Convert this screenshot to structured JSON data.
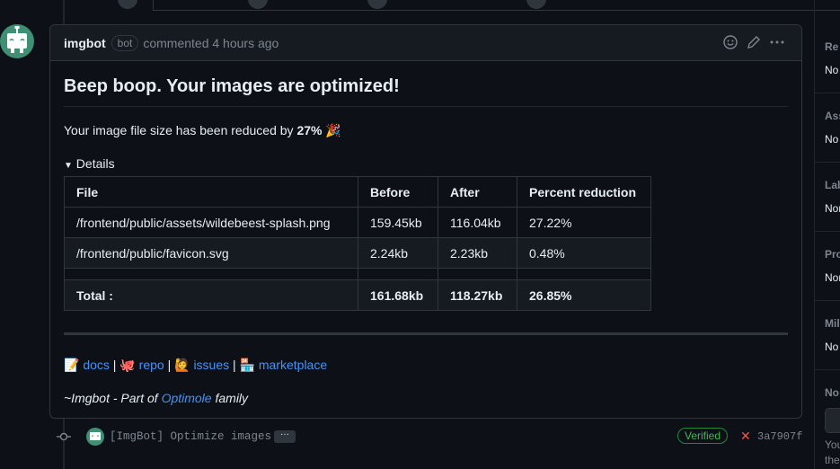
{
  "comment": {
    "author": "imgbot",
    "badge": "bot",
    "meta": "commented 4 hours ago",
    "title": "Beep boop. Your images are optimized!",
    "summary_prefix": "Your image file size has been reduced by ",
    "summary_percent": "27%",
    "summary_emoji": "🎉",
    "details_label": "Details",
    "table": {
      "headers": [
        "File",
        "Before",
        "After",
        "Percent reduction"
      ],
      "rows": [
        [
          "/frontend/public/assets/wildebeest-splash.png",
          "159.45kb",
          "116.04kb",
          "27.22%"
        ],
        [
          "/frontend/public/favicon.svg",
          "2.24kb",
          "2.23kb",
          "0.48%"
        ]
      ],
      "total": [
        "Total :",
        "161.68kb",
        "118.27kb",
        "26.85%"
      ]
    },
    "links": {
      "docs_emoji": "📝",
      "docs": "docs",
      "repo_emoji": "🐙",
      "repo": "repo",
      "issues_emoji": "🙋",
      "issues": "issues",
      "marketplace_emoji": "🏪",
      "marketplace": "marketplace",
      "separator": "|"
    },
    "footer_prefix": "~Imgbot - Part of ",
    "footer_link": "Optimole",
    "footer_suffix": " family"
  },
  "commit": {
    "message": "[ImgBot] Optimize images",
    "ellipsis": "···",
    "verified": "Verified",
    "status_icon": "✕",
    "sha": "3a7907f"
  },
  "sidebar": {
    "sections": [
      {
        "label": "Re",
        "value": "No"
      },
      {
        "label": "Ass",
        "value": "No"
      },
      {
        "label": "Lab",
        "value": "Nor"
      },
      {
        "label": "Pro",
        "value": "Nor"
      },
      {
        "label": "Mil",
        "value": "No"
      },
      {
        "label": "No",
        "value": ""
      }
    ],
    "tail": [
      "You",
      "the"
    ]
  },
  "icons": {
    "emoji_icon": "smiley-icon",
    "edit_icon": "pencil-icon",
    "more_icon": "kebab-horizontal-icon",
    "disclosure": "triangle-down-icon",
    "commit_icon": "git-commit-icon",
    "bot_avatar": "robot-icon"
  },
  "colors": {
    "background": "#0d1117",
    "link": "#4493f8",
    "verified": "#3fb950",
    "fail": "#f85149",
    "bot_avatar": "#3f8f74"
  }
}
